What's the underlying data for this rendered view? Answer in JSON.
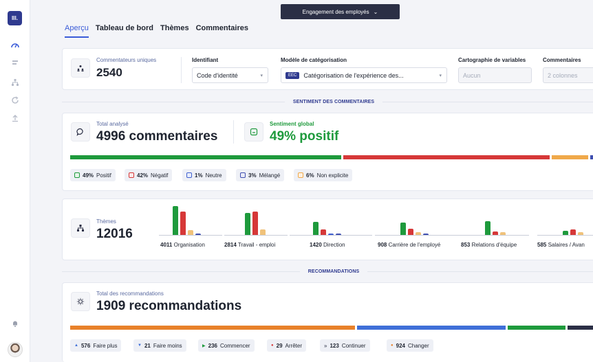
{
  "sidebar": {
    "logo": "III."
  },
  "header": {
    "dropdown_label": "Engagement des employés"
  },
  "tabs": [
    {
      "label": "Aperçu",
      "active": true
    },
    {
      "label": "Tableau de bord",
      "active": false
    },
    {
      "label": "Thèmes",
      "active": false
    },
    {
      "label": "Commentaires",
      "active": false
    }
  ],
  "summary": {
    "unique_label": "Commentateurs uniques",
    "unique_value": "2540",
    "identifier_label": "Identifiant",
    "identifier_value": "Code d'identité",
    "model_label": "Modèle de catégorisation",
    "model_tag": "EEC",
    "model_value": "Catégorisation de l'expérience des...",
    "mapping_label": "Cartographie de variables",
    "mapping_placeholder": "Aucun",
    "comments_label": "Commentaires",
    "comments_placeholder": "2 colonnes"
  },
  "sentiment_section": {
    "title": "SENTIMENT DES COMMENTAIRES",
    "total_label": "Total analysé",
    "total_value": "4996 commentaires",
    "global_label": "Sentiment global",
    "global_value": "49% positif",
    "chips": [
      {
        "pct": "49%",
        "label": "Positif",
        "color": "#1e9a3c"
      },
      {
        "pct": "42%",
        "label": "Négatif",
        "color": "#d63838"
      },
      {
        "pct": "1%",
        "label": "Neutre",
        "color": "#3f5fd0"
      },
      {
        "pct": "3%",
        "label": "Mélangé",
        "color": "#3f4fb0"
      },
      {
        "pct": "6%",
        "label": "Non explicite",
        "color": "#f0a94a"
      }
    ]
  },
  "themes_section": {
    "label": "Thèmes",
    "value": "12016",
    "themes": [
      {
        "count": "4011",
        "name": "Organisation"
      },
      {
        "count": "2814",
        "name": "Travail - emploi"
      },
      {
        "count": "1420",
        "name": "Direction"
      },
      {
        "count": "908",
        "name": "Carrière de l'employé"
      },
      {
        "count": "853",
        "name": "Relations d'équipe"
      },
      {
        "count": "585",
        "name": "Salaires / Avan"
      }
    ]
  },
  "recommendations_section": {
    "title": "RECOMMANDATIONS",
    "total_label": "Total des recommandations",
    "total_value": "1909 recommandations",
    "chips": [
      {
        "count": "576",
        "label": "Faire plus",
        "color": "#3f6fd8",
        "glyph": "▲"
      },
      {
        "count": "21",
        "label": "Faire moins",
        "color": "#3f6fd8",
        "glyph": "▼"
      },
      {
        "count": "236",
        "label": "Commencer",
        "color": "#1e9a3c",
        "glyph": "▶"
      },
      {
        "count": "29",
        "label": "Arrêter",
        "color": "#d63838",
        "glyph": "●"
      },
      {
        "count": "123",
        "label": "Continuer",
        "color": "#2b2f45",
        "glyph": "»"
      },
      {
        "count": "924",
        "label": "Changer",
        "color": "#e8812a",
        "glyph": "●"
      }
    ]
  }
}
